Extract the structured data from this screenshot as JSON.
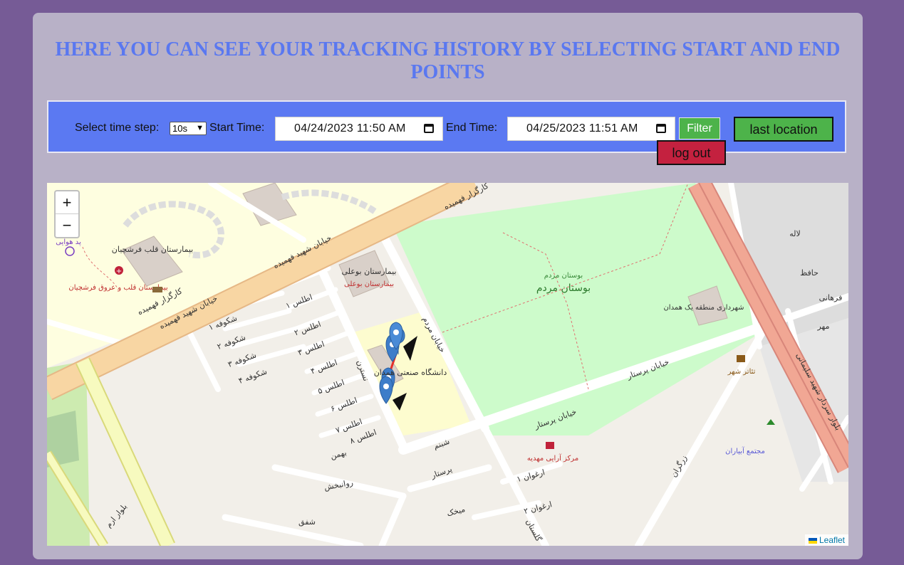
{
  "header": {
    "title": "HERE YOU CAN SEE YOUR TRACKING HISTORY BY SELECTING START AND END POINTS"
  },
  "filter": {
    "time_step_label": "Select time step:",
    "time_step_value": "10s",
    "start_label": "Start Time:",
    "start_value": "04/24/2023  11:50  AM",
    "end_label": "End Time:",
    "end_value": "04/25/2023  11:51  AM",
    "filter_button": "Filter",
    "last_location_button": "last location",
    "logout_button": "log out"
  },
  "map": {
    "zoom_in": "+",
    "zoom_out": "−",
    "attribution": "Leaflet",
    "markers": 5,
    "labels": {
      "hospital_fahmideh": "بیمارستان قلب فرشچیان",
      "hospital_red": "بیمارستان قلب و عروق فرشچیان",
      "park": "بوستان مردم",
      "park_small": "بوستان مردم",
      "street_fahmideh": "خیابان شهید فهمیده",
      "street_fahmideh2": "خیابان شهید فهمیده",
      "street_kargar1": "کارگزار فهمیده",
      "street_kargar2": "کارگزار فهمیده",
      "street_mardom": "خیابان مردم",
      "street_parastar": "خیابان پرستار",
      "street_parastar2": "خیابان پرستار",
      "street_parastar3": "پرستار",
      "hospital_buali": "بیمارستان بوعلی",
      "hospital_buali_red": "بیمارستان بوعلی",
      "university": "دانشگاه صنعتی همدان",
      "municipality": "شهرداری منطقه یک همدان",
      "theatre": "تئاتر شهر",
      "mall": "مرکز آرایی مهدیه",
      "complex": "مجتمع آبیاران",
      "blvd": "بلوار ارم",
      "blvd_soleimani": "بلوار سردار شهید سلیمانی",
      "helipad": "پد هوایی",
      "atlas": [
        "اطلس ۱",
        "اطلس ۲",
        "اطلس ۳",
        "اطلس ۴",
        "اطلس ۵",
        "اطلس ۶",
        "اطلس ۷",
        "اطلس ۸"
      ],
      "shokufeh": [
        "شکوفه ۱",
        "شکوفه ۲",
        "شکوفه ۳",
        "شکوفه ۴"
      ],
      "bahman": "بهمن",
      "ravanbakhsh": "روانبخش",
      "shafagh": "شفق",
      "mikhak": "میخک",
      "arghavan1": "ارغوان ۱",
      "arghavan2": "ارغوان ۲",
      "golestan": "گلستان",
      "shabnam": "شبنم",
      "mehr": "مهر",
      "hafez": "حافظ",
      "laleh": "لاله",
      "farahani": "فرهانی",
      "zargaran": "زرگران",
      "nastaran": "نسترن"
    }
  }
}
